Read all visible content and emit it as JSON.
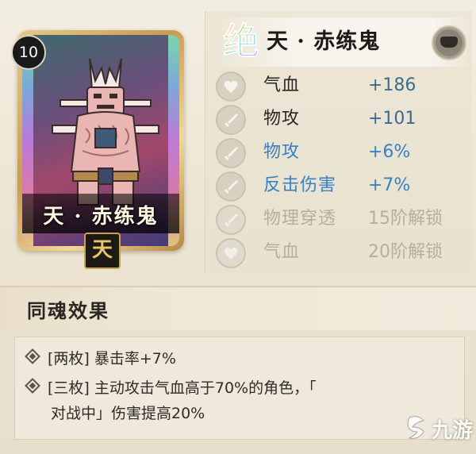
{
  "card": {
    "level": "10",
    "name": "天 · 赤练鬼",
    "badge": "天"
  },
  "header": {
    "rank_glyph": "绝",
    "title": "天 · 赤练鬼",
    "slot_icon": "bowl-slot-icon"
  },
  "stats": [
    {
      "icon": "heart-icon",
      "label": "气血",
      "value": "+186",
      "style": "normal"
    },
    {
      "icon": "sword-icon",
      "label": "物攻",
      "value": "+101",
      "style": "normal"
    },
    {
      "icon": "sword-icon",
      "label": "物攻",
      "value": "+6%",
      "style": "blue"
    },
    {
      "icon": "sword-icon",
      "label": "反击伤害",
      "value": "+7%",
      "style": "blue"
    },
    {
      "icon": "sword-icon",
      "label": "物理穿透",
      "value": "15阶解锁",
      "style": "locked"
    },
    {
      "icon": "heart-icon",
      "label": "气血",
      "value": "20阶解锁",
      "style": "locked"
    }
  ],
  "section": {
    "title": "同魂效果"
  },
  "effects": [
    {
      "tag": "[两枚]",
      "text": "暴击率+7%"
    },
    {
      "tag": "[三枚]",
      "text": "主动攻击气血高于70%的角色，「"
    },
    {
      "tag": "",
      "text": "对战中」伤害提高20%"
    }
  ],
  "watermark": {
    "text": "九游"
  },
  "colors": {
    "blue_stat": "#3b7fc4",
    "value_default": "#3f6a8f",
    "locked": "#b5aea0",
    "background": "#ece5d3"
  }
}
